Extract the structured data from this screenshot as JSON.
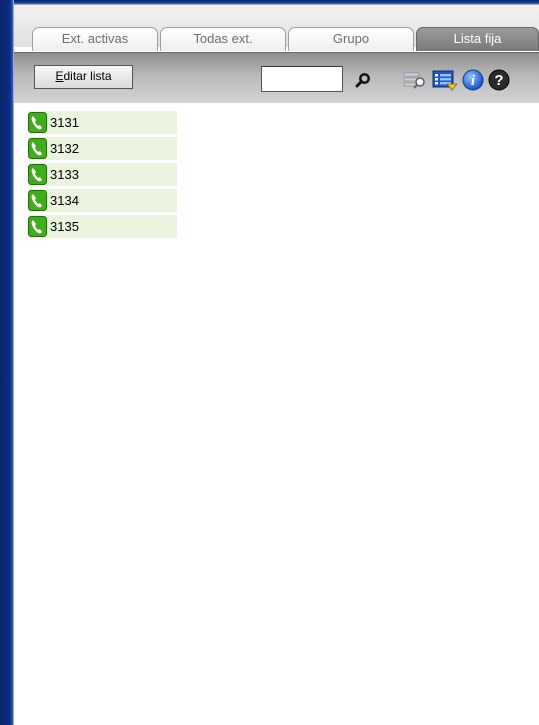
{
  "tabs": [
    {
      "label": "Ext. activas",
      "active": false
    },
    {
      "label": "Todas ext.",
      "active": false
    },
    {
      "label": "Grupo",
      "active": false
    },
    {
      "label": "Lista fija",
      "active": true
    }
  ],
  "toolbar": {
    "edit_button": {
      "prefix": "E",
      "rest": "ditar lista"
    },
    "search_value": "",
    "icons": [
      "search-icon",
      "search-list-icon",
      "view-options-icon",
      "info-icon",
      "help-icon"
    ]
  },
  "extensions": [
    {
      "number": "3131",
      "icon": "phone-icon"
    },
    {
      "number": "3132",
      "icon": "phone-icon"
    },
    {
      "number": "3133",
      "icon": "phone-icon"
    },
    {
      "number": "3134",
      "icon": "phone-icon"
    },
    {
      "number": "3135",
      "icon": "phone-icon"
    }
  ],
  "colors": {
    "frame": "#0a246a",
    "item_bg": "#e9f3dd",
    "phone_green": "#3fae1a"
  }
}
